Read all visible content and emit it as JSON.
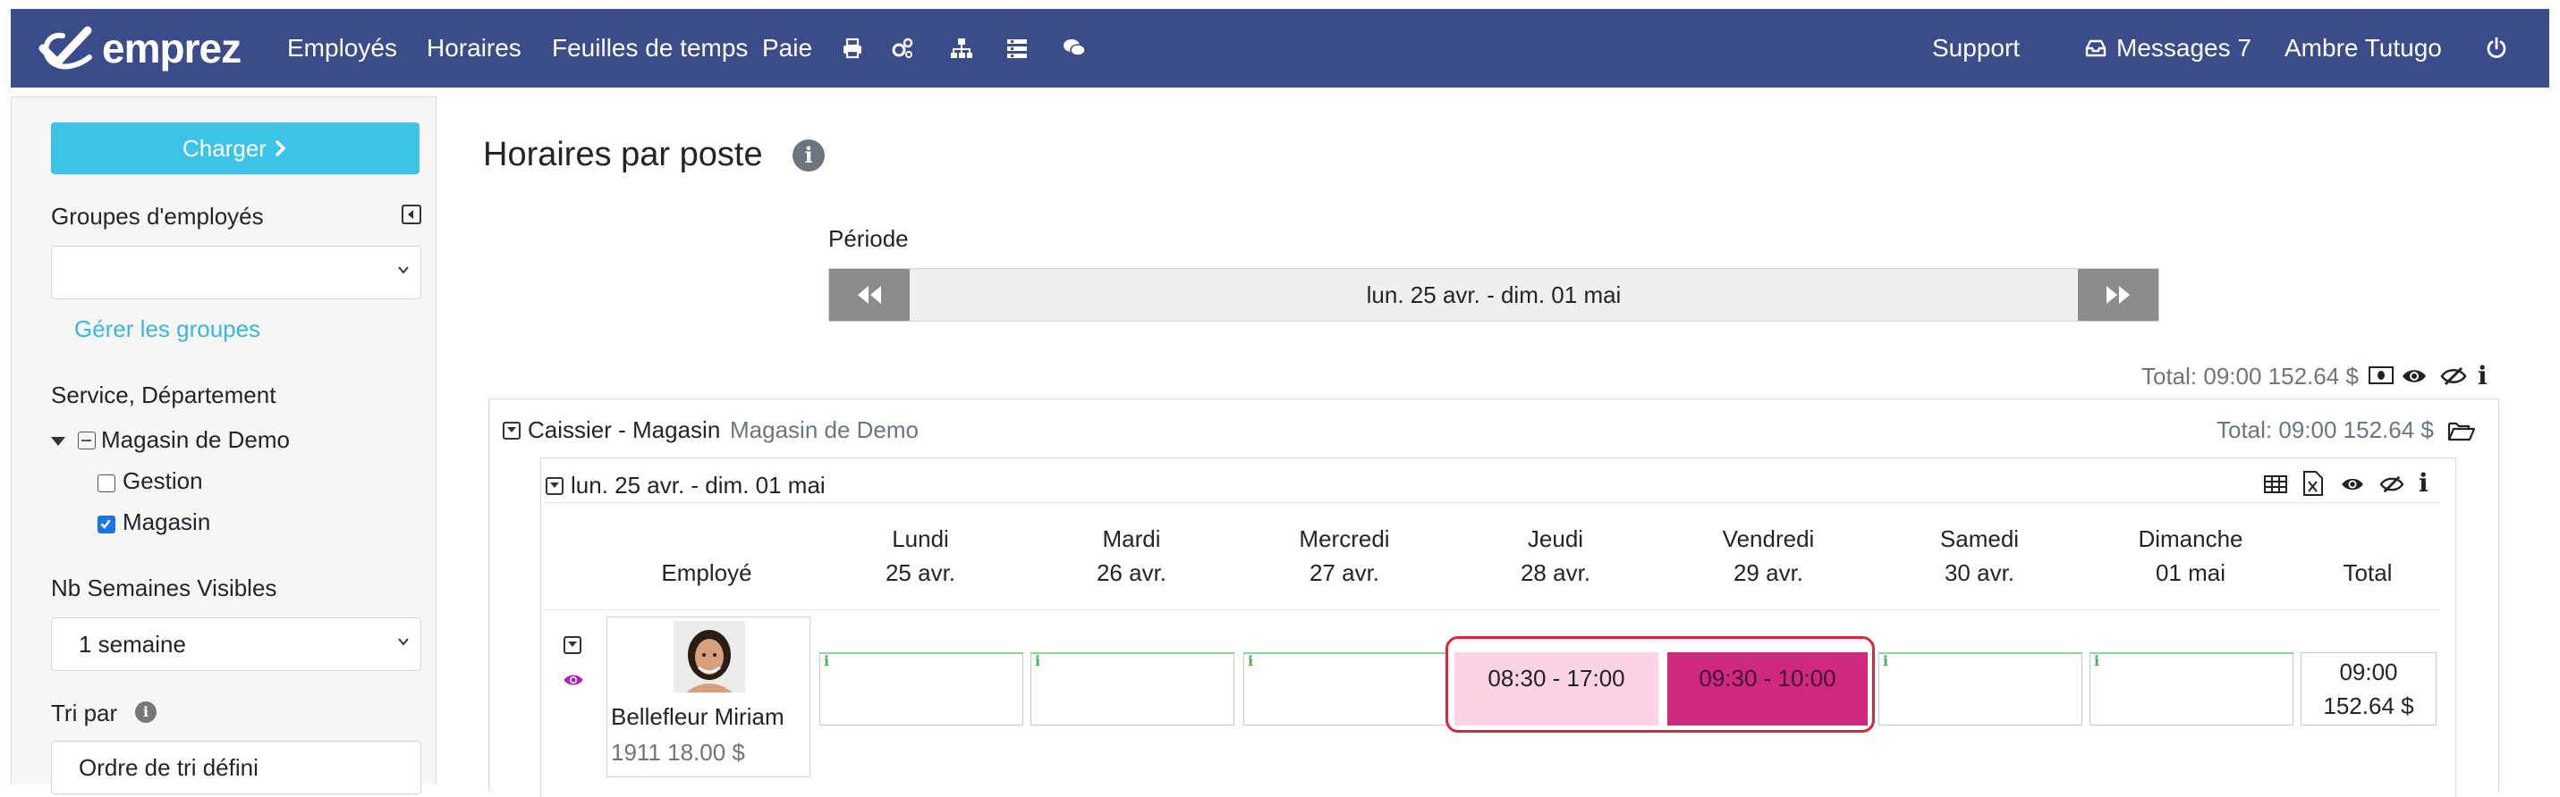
{
  "nav": {
    "brand": "emprez",
    "links": [
      "Employés",
      "Horaires",
      "Feuilles de temps",
      "Paie"
    ],
    "icons": [
      "printer-icon",
      "gears-icon",
      "org-chart-icon",
      "list-icon",
      "comments-icon"
    ],
    "support": "Support",
    "messages": "Messages 7",
    "user": "Ambre Tutugo",
    "bg_color": "#3b4c8a"
  },
  "sidebar": {
    "load_button": "Charger",
    "employee_groups_label": "Groupes d'employés",
    "employee_groups_value": "",
    "manage_groups_link": "Gérer les groupes",
    "department_label": "Service, Département",
    "tree": {
      "root": "Magasin de Demo",
      "children": [
        {
          "label": "Gestion",
          "checked": false
        },
        {
          "label": "Magasin",
          "checked": true
        }
      ]
    },
    "weeks_label": "Nb Semaines Visibles",
    "weeks_value": "1 semaine",
    "sort_label": "Tri par",
    "sort_value": "Ordre de tri défini"
  },
  "main": {
    "title": "Horaires par poste",
    "period_label": "Période",
    "period_value": "lun. 25 avr. - dim. 01 mai",
    "grand_total": "Total: 09:00 152.64 $",
    "group": {
      "title": "Caissier - Magasin",
      "subtitle": "Magasin de Demo",
      "total": "Total: 09:00 152.64 $",
      "week": {
        "title": "lun. 25 avr. - dim. 01 mai",
        "employee_header": "Employé",
        "days": [
          {
            "name": "Lundi",
            "date": "25 avr."
          },
          {
            "name": "Mardi",
            "date": "26 avr."
          },
          {
            "name": "Mercredi",
            "date": "27 avr."
          },
          {
            "name": "Jeudi",
            "date": "28 avr."
          },
          {
            "name": "Vendredi",
            "date": "29 avr."
          },
          {
            "name": "Samedi",
            "date": "30 avr."
          },
          {
            "name": "Dimanche",
            "date": "01 mai"
          }
        ],
        "total_header": "Total",
        "row": {
          "employee_name": "Bellefleur Miriam",
          "employee_meta": "1911 18.00 $",
          "shifts": {
            "thursday": "08:30 - 17:00",
            "friday": "09:30 - 10:00"
          },
          "total_hours": "09:00",
          "total_amount": "152.64 $"
        }
      }
    },
    "colors": {
      "load_button": "#3cc3e8",
      "shift_thursday": "#fcd3e6",
      "shift_friday": "#d0287f",
      "highlight": "#d6283c",
      "link": "#3bb6e0"
    }
  }
}
